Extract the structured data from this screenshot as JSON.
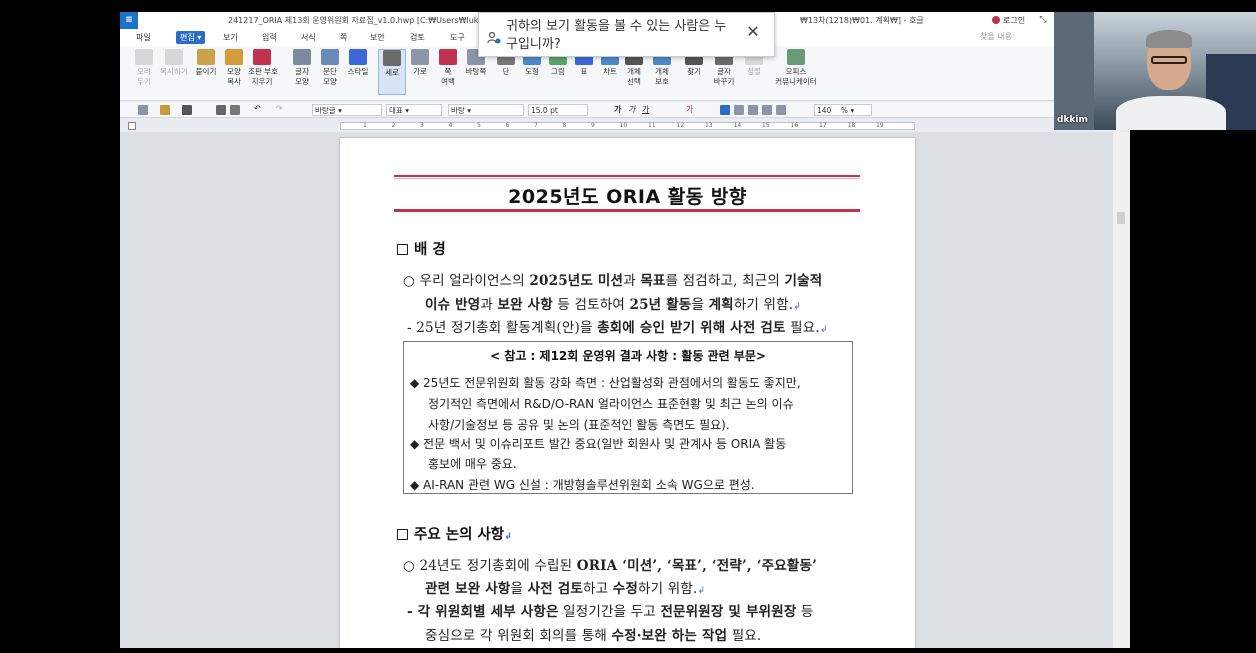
{
  "window": {
    "title_left": "241217_ORIA 제13회 운영위원회 자료집_v1.0.hwp [C:₩Users₩lukis₩",
    "title_right": "₩13차(1218)₩01. 계획₩] - 호글",
    "login_label": "로그인",
    "sidebar_label": "찾을 내용"
  },
  "menu": {
    "items": [
      "파일",
      "편집",
      "보기",
      "입력",
      "서식",
      "쪽",
      "보안",
      "검토",
      "도구"
    ],
    "active": "편집"
  },
  "ribbon": {
    "buttons": [
      {
        "label": "오려\n두기",
        "enabled": false
      },
      {
        "label": "복사하기",
        "enabled": false
      },
      {
        "label": "붙이기",
        "enabled": true
      },
      {
        "label": "모양\n복사",
        "enabled": true
      },
      {
        "label": "조판 부호\n지우기",
        "enabled": true
      },
      {
        "label": "글자\n모양",
        "enabled": true
      },
      {
        "label": "문단\n모양",
        "enabled": true
      },
      {
        "label": "스타일",
        "enabled": true
      },
      {
        "label": "세로",
        "enabled": true,
        "selected": true
      },
      {
        "label": "가로",
        "enabled": true
      },
      {
        "label": "쪽\n여백",
        "enabled": true
      },
      {
        "label": "바탕쪽",
        "enabled": true
      },
      {
        "label": "단",
        "enabled": true
      },
      {
        "label": "도형",
        "enabled": true
      },
      {
        "label": "그림",
        "enabled": true
      },
      {
        "label": "표",
        "enabled": true
      },
      {
        "label": "차트",
        "enabled": true
      },
      {
        "label": "개체\n선택",
        "enabled": true
      },
      {
        "label": "개체\n보호",
        "enabled": true
      },
      {
        "label": "찾기",
        "enabled": true
      },
      {
        "label": "글자\n바꾸기",
        "enabled": true
      },
      {
        "label": "정렬",
        "enabled": false
      },
      {
        "label": "오피스\n커뮤니케이터",
        "enabled": true
      }
    ]
  },
  "formatbar": {
    "style": "바탕글",
    "lang": "대표",
    "font": "바탕",
    "size": "15.0",
    "size_unit": "pt",
    "zoom": "140",
    "zoom_unit": "%"
  },
  "ruler": {
    "ticks": [
      "1",
      "2",
      "3",
      "4",
      "5",
      "6",
      "7",
      "8",
      "9",
      "10",
      "11",
      "12",
      "13",
      "14",
      "15",
      "16",
      "17",
      "18",
      "19"
    ]
  },
  "document": {
    "title": "2025년도 ORIA 활동 방향",
    "section1_heading": "배 경",
    "bg_line1a": "○ 우리 얼라이언스의 ",
    "bg_line1b": "2025년도 미션",
    "bg_line1c": "과 ",
    "bg_line1d": "목표",
    "bg_line1e": "를 점검하고, 최근의 ",
    "bg_line1f": "기술적",
    "bg_line2a": "이슈 반영",
    "bg_line2b": "과 ",
    "bg_line2c": "보완 사항",
    "bg_line2d": " 등 검토하여 ",
    "bg_line2e": "25년 활동",
    "bg_line2f": "을 ",
    "bg_line2g": "계획",
    "bg_line2h": "하기 위함.",
    "bg_line3a": "- 25년 정기총회 활동계획(안)을 ",
    "bg_line3b": "총회에 승인 받기 위해 사전 검토",
    "bg_line3c": " 필요.",
    "ref_title": "< 참고 : 제12회 운영위 결과 사항 : 활동 관련 부문>",
    "ref_line1": "◆ 25년도 전문위원회 활동 강화 측면 :  산업활성화 관점에서의 활동도 좋지만,",
    "ref_line2": "정기적인 측면에서 R&D/O-RAN 얼라이언스 표준현황 및 최근 논의 이슈",
    "ref_line3": "사항/기술정보 등 공유 및 논의 (표준적인 활동 측면도 필요).",
    "ref_line4": "◆ 전문 백서 및 이슈리포트 발간 중요(일반 회원사 및 관계사 등 ORIA 활동",
    "ref_line5": "홍보에 매우 중요.",
    "ref_line6": "◆ AI-RAN 관련 WG 신설 : 개방형솔루션위원회 소속 WG으로 편성.",
    "section2_heading": "주요 논의 사항",
    "iss_line1a": "○ 24년도 정기총회에 수립된 ",
    "iss_line1b": "ORIA ‘미션’, ‘목표’, ‘전략’, ‘주요활동’",
    "iss_line2a": "관련 보완 사항",
    "iss_line2b": "을 ",
    "iss_line2c": "사전 검토",
    "iss_line2d": "하고 ",
    "iss_line2e": "수정",
    "iss_line2f": "하기 위함.",
    "iss_line3a": "- 각 위원회별 세부 사항은",
    "iss_line3b": " 일정기간을 두고 ",
    "iss_line3c": "전문위원장 및 부위원장",
    "iss_line3d": " 등",
    "iss_line4a": "중심으로 각 위원회 회의를 통해 ",
    "iss_line4b": "수정·보완 하는 작업",
    "iss_line4c": " 필요."
  },
  "viewer_dialog": {
    "message": "귀하의 보기 활동을 볼 수 있는 사람은 누구입니까?"
  },
  "webcam": {
    "participant_name": "dkkim"
  },
  "colors": {
    "accent_blue": "#2b6cc4",
    "title_rule": "#c0344f"
  }
}
